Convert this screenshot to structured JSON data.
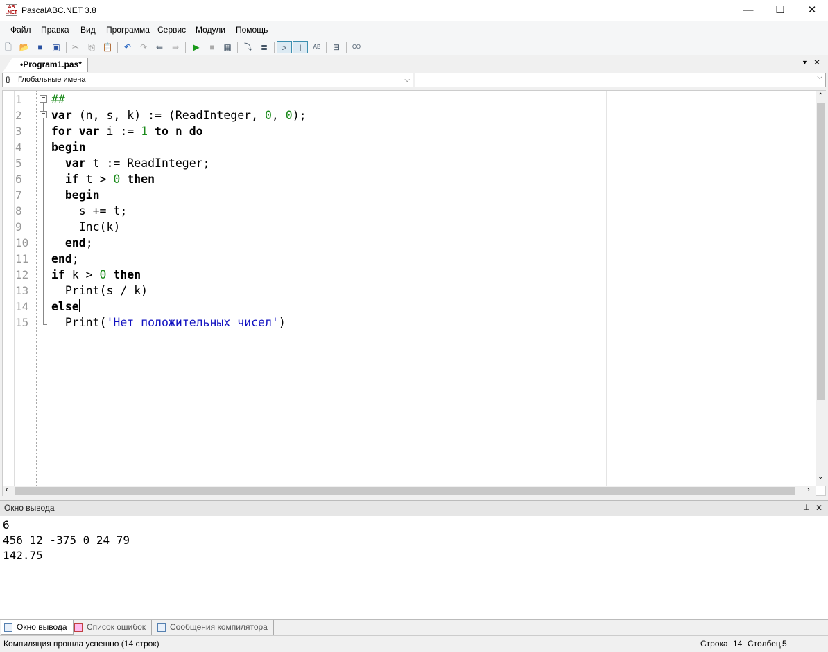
{
  "window": {
    "title": "PascalABC.NET 3.8",
    "logo": "AB .NET",
    "minimize": "—",
    "maximize": "☐",
    "close": "✕"
  },
  "menu": [
    "Файл",
    "Правка",
    "Вид",
    "Программа",
    "Сервис",
    "Модули",
    "Помощь"
  ],
  "toolbar_icons": [
    "new-file",
    "open",
    "save",
    "save-all",
    "cut",
    "copy",
    "paste",
    "undo",
    "redo",
    "navigate-back",
    "navigate-forward",
    "run",
    "stop",
    "debug",
    "step-into",
    "step-over",
    "output-toggle",
    "text-toggle",
    "format",
    "code-template",
    "code-snippet"
  ],
  "tab": {
    "label": "•Program1.pas*",
    "menu": "▼",
    "close": "✕"
  },
  "combo": {
    "scope": "Глобальные имена",
    "member": ""
  },
  "code": [
    [
      [
        "cmt",
        "##"
      ]
    ],
    [
      [
        "kw",
        "var"
      ],
      [
        "p",
        " (n, s, k) := (ReadInteger, "
      ],
      [
        "num",
        "0"
      ],
      [
        "p",
        ", "
      ],
      [
        "num",
        "0"
      ],
      [
        "p",
        ");"
      ]
    ],
    [
      [
        "kw",
        "for"
      ],
      [
        "p",
        " "
      ],
      [
        "kw",
        "var"
      ],
      [
        "p",
        " i := "
      ],
      [
        "num",
        "1"
      ],
      [
        "p",
        " "
      ],
      [
        "kw",
        "to"
      ],
      [
        "p",
        " n "
      ],
      [
        "kw",
        "do"
      ]
    ],
    [
      [
        "kw",
        "begin"
      ]
    ],
    [
      [
        "p",
        "  "
      ],
      [
        "kw",
        "var"
      ],
      [
        "p",
        " t := ReadInteger;"
      ]
    ],
    [
      [
        "p",
        "  "
      ],
      [
        "kw",
        "if"
      ],
      [
        "p",
        " t > "
      ],
      [
        "num",
        "0"
      ],
      [
        "p",
        " "
      ],
      [
        "kw",
        "then"
      ]
    ],
    [
      [
        "p",
        "  "
      ],
      [
        "kw",
        "begin"
      ]
    ],
    [
      [
        "p",
        "    s += t;"
      ]
    ],
    [
      [
        "p",
        "    Inc(k)"
      ]
    ],
    [
      [
        "p",
        "  "
      ],
      [
        "kw",
        "end"
      ],
      [
        "p",
        ";"
      ]
    ],
    [
      [
        "kw",
        "end"
      ],
      [
        "p",
        ";"
      ]
    ],
    [
      [
        "kw",
        "if"
      ],
      [
        "p",
        " k > "
      ],
      [
        "num",
        "0"
      ],
      [
        "p",
        " "
      ],
      [
        "kw",
        "then"
      ]
    ],
    [
      [
        "p",
        "  Print(s / k)"
      ]
    ],
    [
      [
        "kw",
        "else"
      ]
    ],
    [
      [
        "p",
        "  Print("
      ],
      [
        "str",
        "'Нет положительных чисел'"
      ],
      [
        "p",
        ")"
      ]
    ]
  ],
  "output": {
    "title": "Окно вывода",
    "pin": "📌",
    "close": "✕",
    "lines": [
      "6",
      "456 12 -375 0 24 79",
      "142.75"
    ]
  },
  "bottom_tabs": [
    "Окно вывода",
    "Список ошибок",
    "Сообщения компилятора"
  ],
  "status": {
    "message": "Компиляция прошла успешно (14 строк)",
    "row_label": "Строка",
    "row": "14",
    "col_label": "Столбец",
    "col": "5"
  }
}
